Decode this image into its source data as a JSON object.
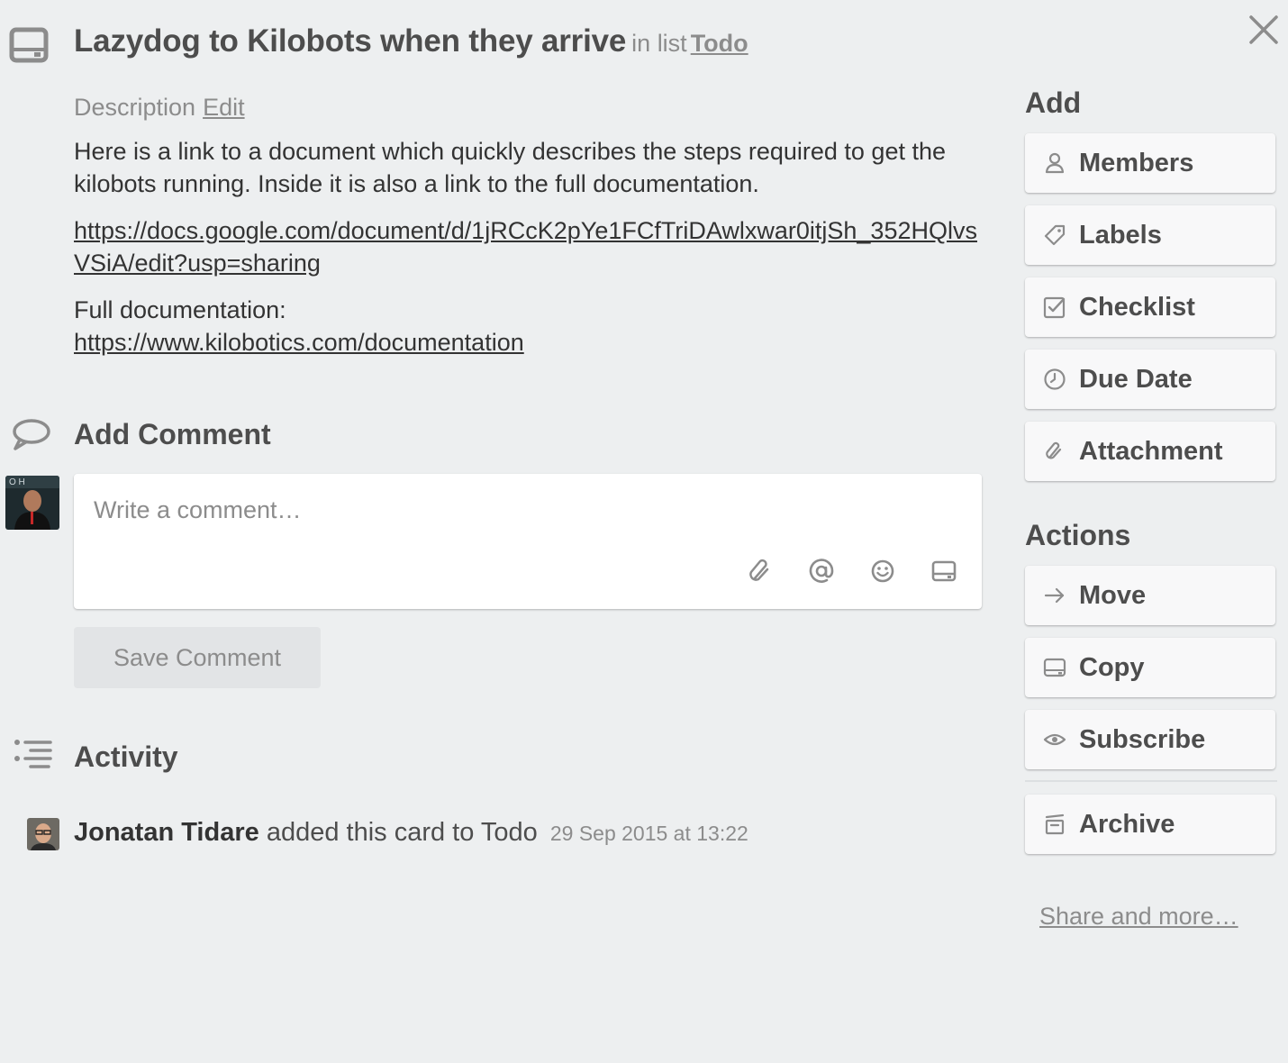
{
  "header": {
    "title": "Lazydog to Kilobots when they arrive",
    "in_list_prefix": "in list",
    "list_name": "Todo"
  },
  "description": {
    "label": "Description",
    "edit_label": "Edit",
    "paragraph": "Here is a link to a document which quickly describes the steps required to get the kilobots running. Inside it is also a link to the full documentation.",
    "doc_link": "https://docs.google.com/document/d/1jRCcK2pYe1FCfTriDAwlxwar0itjSh_352HQlvsVSiA/edit?usp=sharing",
    "full_doc_label": "Full documentation:",
    "full_doc_link": "https://www.kilobotics.com/documentation"
  },
  "comment": {
    "heading": "Add Comment",
    "placeholder": "Write a comment…",
    "save_label": "Save Comment",
    "icons": [
      "attachment-icon",
      "mention-icon",
      "emoji-icon",
      "card-icon"
    ]
  },
  "activity": {
    "heading": "Activity",
    "items": [
      {
        "user": "Jonatan Tidare",
        "action": "added this card to Todo",
        "date": "29 Sep 2015 at 13:22"
      }
    ]
  },
  "sidebar": {
    "add_heading": "Add",
    "add_buttons": [
      {
        "label": "Members",
        "icon": "person-icon"
      },
      {
        "label": "Labels",
        "icon": "label-icon"
      },
      {
        "label": "Checklist",
        "icon": "checklist-icon"
      },
      {
        "label": "Due Date",
        "icon": "clock-icon"
      },
      {
        "label": "Attachment",
        "icon": "attachment-icon"
      }
    ],
    "actions_heading": "Actions",
    "action_buttons": [
      {
        "label": "Move",
        "icon": "arrow-right-icon"
      },
      {
        "label": "Copy",
        "icon": "card-icon"
      },
      {
        "label": "Subscribe",
        "icon": "eye-icon"
      },
      {
        "label": "Archive",
        "icon": "archive-icon"
      }
    ],
    "share_label": "Share and more…"
  },
  "colors": {
    "background": "#edeff0",
    "text": "#4d4d4d",
    "muted": "#8c8c8c",
    "button_bg": "#f8f8f9"
  }
}
